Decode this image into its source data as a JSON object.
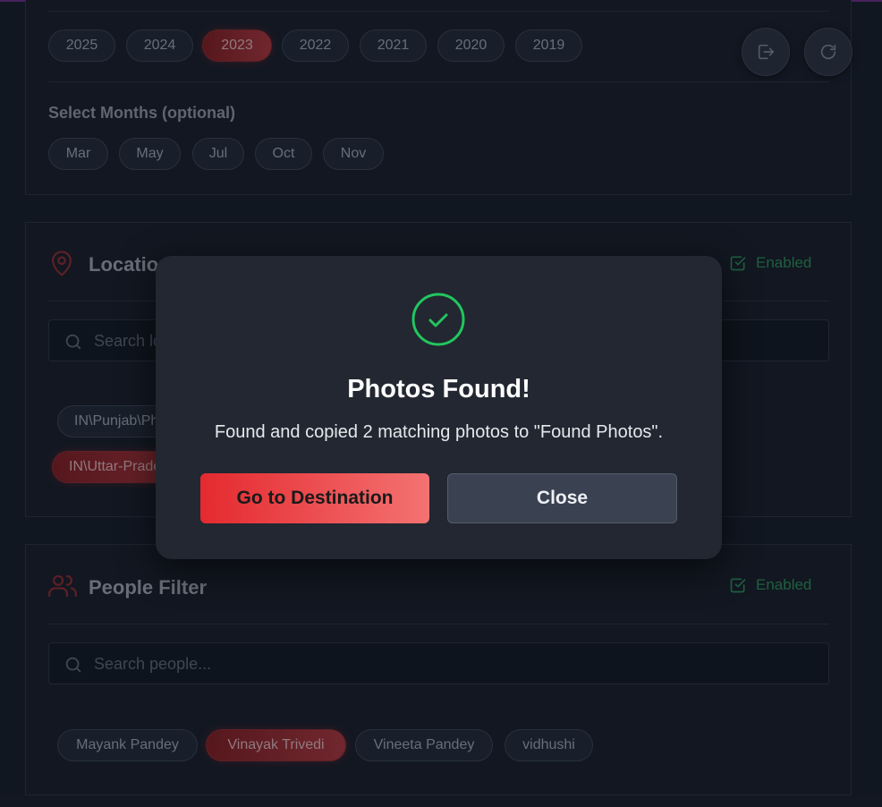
{
  "years": {
    "items": [
      "2025",
      "2024",
      "2023",
      "2022",
      "2021",
      "2020",
      "2019"
    ],
    "selected": "2023"
  },
  "months": {
    "label": "Select Months (optional)",
    "items": [
      "Mar",
      "May",
      "Jul",
      "Oct",
      "Nov"
    ]
  },
  "location": {
    "title": "Location",
    "enabled_label": "Enabled",
    "search_placeholder": "Search locations...",
    "chips": [
      "IN\\Punjab\\Phagwara",
      "IN\\Uttar-Pradesh"
    ],
    "selected": "IN\\Uttar-Pradesh"
  },
  "people": {
    "title": "People Filter",
    "enabled_label": "Enabled",
    "search_placeholder": "Search people...",
    "chips": [
      "Mayank Pandey",
      "Vinayak Trivedi",
      "Vineeta Pandey",
      "vidhushi"
    ],
    "selected": "Vinayak Trivedi"
  },
  "modal": {
    "title": "Photos Found!",
    "message": "Found and copied 2 matching photos to \"Found Photos\".",
    "primary_label": "Go to Destination",
    "secondary_label": "Close"
  },
  "colors": {
    "accent": "#e42a2f",
    "success": "#22c55e",
    "enabled": "#2c8a56"
  }
}
